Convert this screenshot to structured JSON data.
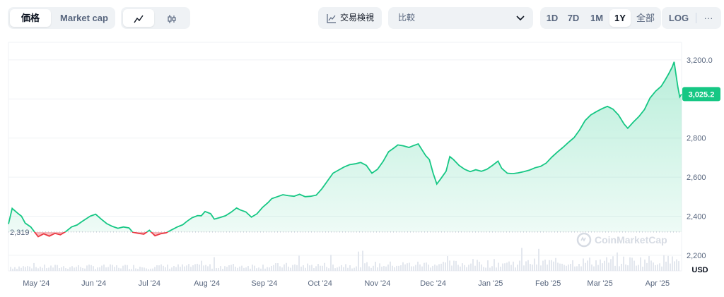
{
  "toolbar": {
    "metric_tabs": [
      "価格",
      "Market cap"
    ],
    "active_metric": "価格",
    "chart_style_icons": [
      "line-chart-icon",
      "candlestick-icon"
    ],
    "tradingview_label": "交易検視",
    "compare_placeholder": "比較",
    "ranges": [
      "1D",
      "7D",
      "1M",
      "1Y",
      "全部",
      "LOG"
    ],
    "active_range": "1Y",
    "more_label": "···"
  },
  "colors": {
    "up": "#16c784",
    "down": "#ea3943",
    "up_fill_top": "#bdeed6"
  },
  "watermark": "CoinMarketCap",
  "chart_data": {
    "type": "line",
    "currency": "USD",
    "ylim": [
      2120,
      3290
    ],
    "yticks": [
      2200,
      2400,
      2600,
      2800,
      3000,
      3200
    ],
    "ytick_labels": [
      "2,200",
      "",
      "2,400",
      "2,600",
      "2,800",
      "3,000",
      "3,200.0"
    ],
    "baseline": 2319,
    "baseline_label": "2,319",
    "current_price": 3025.2,
    "current_label": "3,025.2",
    "xlim": [
      "2024-04-16",
      "2025-04-14"
    ],
    "x_ticks": [
      {
        "date": "2024-05-01",
        "label": "May '24"
      },
      {
        "date": "2024-06-01",
        "label": "Jun '24"
      },
      {
        "date": "2024-07-01",
        "label": "Jul '24"
      },
      {
        "date": "2024-08-01",
        "label": "Aug '24"
      },
      {
        "date": "2024-09-01",
        "label": "Sep '24"
      },
      {
        "date": "2024-10-01",
        "label": "Oct '24"
      },
      {
        "date": "2024-11-01",
        "label": "Nov '24"
      },
      {
        "date": "2024-12-01",
        "label": "Dec '24"
      },
      {
        "date": "2025-01-01",
        "label": "Jan '25"
      },
      {
        "date": "2025-02-01",
        "label": "Feb '25"
      },
      {
        "date": "2025-03-01",
        "label": "Mar '25"
      },
      {
        "date": "2025-04-01",
        "label": "Apr '25"
      }
    ],
    "series": [
      {
        "points": [
          [
            "2024-04-16",
            2360
          ],
          [
            "2024-04-18",
            2440
          ],
          [
            "2024-04-21",
            2415
          ],
          [
            "2024-04-23",
            2400
          ],
          [
            "2024-04-25",
            2365
          ],
          [
            "2024-04-28",
            2345
          ],
          [
            "2024-04-30",
            2320
          ],
          [
            "2024-05-02",
            2295
          ],
          [
            "2024-05-05",
            2310
          ],
          [
            "2024-05-08",
            2298
          ],
          [
            "2024-05-11",
            2312
          ],
          [
            "2024-05-14",
            2305
          ],
          [
            "2024-05-17",
            2322
          ],
          [
            "2024-05-20",
            2345
          ],
          [
            "2024-05-23",
            2355
          ],
          [
            "2024-05-26",
            2375
          ],
          [
            "2024-05-30",
            2400
          ],
          [
            "2024-06-02",
            2410
          ],
          [
            "2024-06-05",
            2385
          ],
          [
            "2024-06-08",
            2362
          ],
          [
            "2024-06-11",
            2348
          ],
          [
            "2024-06-14",
            2338
          ],
          [
            "2024-06-17",
            2345
          ],
          [
            "2024-06-20",
            2340
          ],
          [
            "2024-06-22",
            2318
          ],
          [
            "2024-06-25",
            2312
          ],
          [
            "2024-06-28",
            2308
          ],
          [
            "2024-07-01",
            2328
          ],
          [
            "2024-07-04",
            2300
          ],
          [
            "2024-07-07",
            2310
          ],
          [
            "2024-07-10",
            2315
          ],
          [
            "2024-07-13",
            2330
          ],
          [
            "2024-07-16",
            2345
          ],
          [
            "2024-07-19",
            2356
          ],
          [
            "2024-07-21",
            2372
          ],
          [
            "2024-07-24",
            2392
          ],
          [
            "2024-07-27",
            2403
          ],
          [
            "2024-07-29",
            2402
          ],
          [
            "2024-07-31",
            2424
          ],
          [
            "2024-08-03",
            2413
          ],
          [
            "2024-08-05",
            2385
          ],
          [
            "2024-08-08",
            2393
          ],
          [
            "2024-08-11",
            2402
          ],
          [
            "2024-08-14",
            2420
          ],
          [
            "2024-08-17",
            2442
          ],
          [
            "2024-08-19",
            2432
          ],
          [
            "2024-08-22",
            2422
          ],
          [
            "2024-08-25",
            2395
          ],
          [
            "2024-08-28",
            2412
          ],
          [
            "2024-08-31",
            2445
          ],
          [
            "2024-09-03",
            2470
          ],
          [
            "2024-09-05",
            2490
          ],
          [
            "2024-09-08",
            2500
          ],
          [
            "2024-09-11",
            2510
          ],
          [
            "2024-09-14",
            2505
          ],
          [
            "2024-09-17",
            2502
          ],
          [
            "2024-09-20",
            2512
          ],
          [
            "2024-09-23",
            2500
          ],
          [
            "2024-09-26",
            2502
          ],
          [
            "2024-09-29",
            2508
          ],
          [
            "2024-10-02",
            2540
          ],
          [
            "2024-10-05",
            2580
          ],
          [
            "2024-10-08",
            2620
          ],
          [
            "2024-10-11",
            2636
          ],
          [
            "2024-10-14",
            2652
          ],
          [
            "2024-10-17",
            2664
          ],
          [
            "2024-10-20",
            2668
          ],
          [
            "2024-10-23",
            2675
          ],
          [
            "2024-10-26",
            2660
          ],
          [
            "2024-10-29",
            2620
          ],
          [
            "2024-11-01",
            2640
          ],
          [
            "2024-11-04",
            2680
          ],
          [
            "2024-11-07",
            2730
          ],
          [
            "2024-11-10",
            2750
          ],
          [
            "2024-11-12",
            2765
          ],
          [
            "2024-11-15",
            2760
          ],
          [
            "2024-11-18",
            2752
          ],
          [
            "2024-11-20",
            2760
          ],
          [
            "2024-11-23",
            2770
          ],
          [
            "2024-11-25",
            2740
          ],
          [
            "2024-11-27",
            2710
          ],
          [
            "2024-11-29",
            2690
          ],
          [
            "2024-12-01",
            2620
          ],
          [
            "2024-12-03",
            2565
          ],
          [
            "2024-12-05",
            2590
          ],
          [
            "2024-12-08",
            2630
          ],
          [
            "2024-12-10",
            2705
          ],
          [
            "2024-12-12",
            2690
          ],
          [
            "2024-12-15",
            2660
          ],
          [
            "2024-12-18",
            2640
          ],
          [
            "2024-12-21",
            2628
          ],
          [
            "2024-12-24",
            2638
          ],
          [
            "2024-12-27",
            2630
          ],
          [
            "2024-12-30",
            2640
          ],
          [
            "2025-01-02",
            2660
          ],
          [
            "2025-01-05",
            2682
          ],
          [
            "2025-01-07",
            2645
          ],
          [
            "2025-01-10",
            2620
          ],
          [
            "2025-01-13",
            2618
          ],
          [
            "2025-01-16",
            2622
          ],
          [
            "2025-01-19",
            2628
          ],
          [
            "2025-01-22",
            2636
          ],
          [
            "2025-01-25",
            2648
          ],
          [
            "2025-01-28",
            2655
          ],
          [
            "2025-01-31",
            2672
          ],
          [
            "2025-02-03",
            2702
          ],
          [
            "2025-02-06",
            2728
          ],
          [
            "2025-02-09",
            2752
          ],
          [
            "2025-02-12",
            2778
          ],
          [
            "2025-02-15",
            2802
          ],
          [
            "2025-02-18",
            2842
          ],
          [
            "2025-02-21",
            2890
          ],
          [
            "2025-02-24",
            2918
          ],
          [
            "2025-02-27",
            2935
          ],
          [
            "2025-03-02",
            2950
          ],
          [
            "2025-03-05",
            2962
          ],
          [
            "2025-03-08",
            2948
          ],
          [
            "2025-03-11",
            2918
          ],
          [
            "2025-03-14",
            2872
          ],
          [
            "2025-03-16",
            2850
          ],
          [
            "2025-03-19",
            2882
          ],
          [
            "2025-03-22",
            2910
          ],
          [
            "2025-03-25",
            2946
          ],
          [
            "2025-03-28",
            3005
          ],
          [
            "2025-03-31",
            3040
          ],
          [
            "2025-04-03",
            3065
          ],
          [
            "2025-04-05",
            3095
          ],
          [
            "2025-04-07",
            3128
          ],
          [
            "2025-04-09",
            3165
          ],
          [
            "2025-04-10",
            3190
          ],
          [
            "2025-04-11",
            3125
          ],
          [
            "2025-04-12",
            3060
          ],
          [
            "2025-04-13",
            3010
          ],
          [
            "2025-04-14",
            3025
          ]
        ]
      }
    ]
  }
}
